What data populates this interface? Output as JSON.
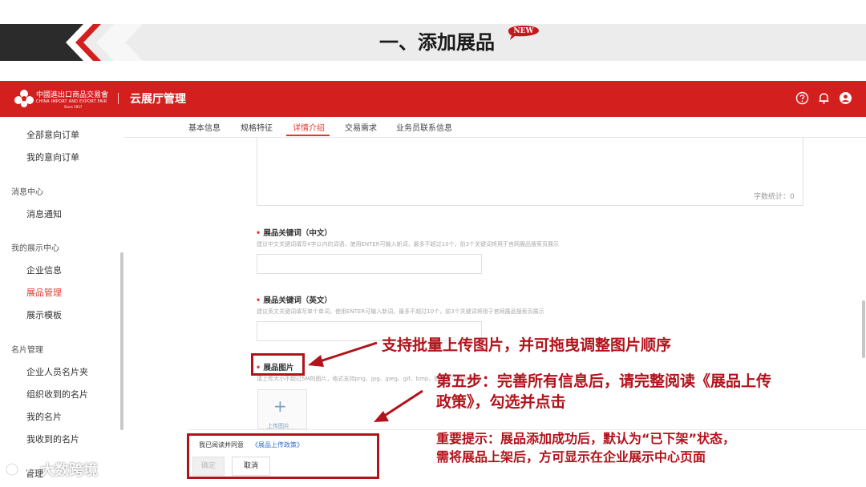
{
  "slide": {
    "title": "一、添加展品",
    "badge": "NEW"
  },
  "header": {
    "logo_cn": "中國進出口商品交易會",
    "logo_en": "CHINA IMPORT AND EXPORT FAIR",
    "logo_since": "Since 1957",
    "app_title": "云展厅管理",
    "icons": [
      "help-icon",
      "bell-icon",
      "user-icon"
    ]
  },
  "sidebar": {
    "items": [
      {
        "label": "全部意向订单"
      },
      {
        "label": "我的意向订单"
      }
    ],
    "groups": [
      {
        "title": "消息中心",
        "items": [
          "消息通知"
        ]
      },
      {
        "title": "我的展示中心",
        "items": [
          "企业信息",
          "展品管理",
          "展示模板"
        ]
      },
      {
        "title": "名片管理",
        "items": [
          "企业人员名片夹",
          "组织收到的名片",
          "我的名片",
          "我收到的名片"
        ]
      }
    ],
    "active": "展品管理",
    "cut_item": "管理"
  },
  "tabs": [
    "基本信息",
    "规格特征",
    "详情介绍",
    "交易需求",
    "业务员联系信息"
  ],
  "active_tab": "详情介绍",
  "form": {
    "word_count": "字数统计：0",
    "keywords_cn": {
      "label": "展品关键词（中文）",
      "hint": "建议中文关键词填写4字以内的词语，使用ENTER可输入新词，最多不超过10个，前3个关键词将用于官网展品搜索页展示"
    },
    "keywords_en": {
      "label": "展品关键词（英文）",
      "hint": "建议英文关键词填写单个单词，使用ENTER可输入新词，最多不超过10个，前3个关键词将用于官网展品搜索页展示"
    },
    "images": {
      "label": "展品图片",
      "hint": "请上传大小不超过5M的图片，格式支持png、jpg、jpeg、gif、bmp，图片尺寸建议800",
      "upload_label": "上传图片"
    }
  },
  "footer": {
    "agree_text": "我已阅读并同意",
    "agree_link": "《展品上传政策》",
    "confirm": "确定",
    "cancel": "取消"
  },
  "annotations": {
    "batch_upload": "支持批量上传图片，并可拖曳调整图片顺序",
    "step5_line1": "第五步：完善所有信息后，请完整阅读《展品上传",
    "step5_line2": "政策》，勾选并点击",
    "tip_line1": "重要提示：展品添加成功后，默认为“已下架”状态，",
    "tip_line2": "需将展品上架后，方可显示在企业展示中心页面"
  },
  "watermark": "大数跨境",
  "colors": {
    "brand_red": "#d41f1f",
    "annotation_red": "#b3121b",
    "active_red": "#e03a2f",
    "link_blue": "#2f6fd0"
  }
}
